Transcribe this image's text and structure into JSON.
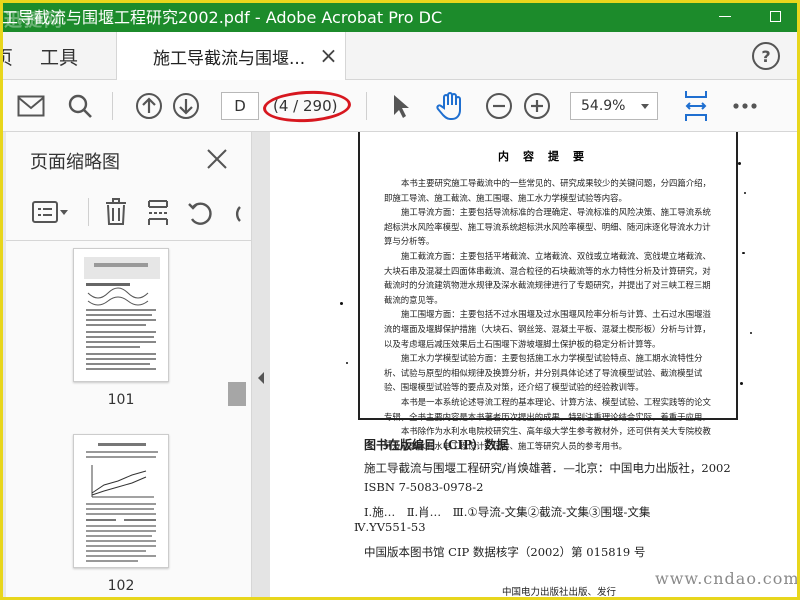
{
  "window": {
    "title": "工导截流与围堰工程研究2002.pdf - Adobe Acrobat Pro DC",
    "watermark": "迅捷网"
  },
  "tabs": {
    "home_partial": "页",
    "tools": "工具",
    "document": "施工导截流与围堰...",
    "close": "×",
    "help": "?"
  },
  "toolbar": {
    "page_input": "D",
    "page_count": "(4 / 290)",
    "zoom": "54.9%"
  },
  "sidepanel": {
    "title": "页面缩略图",
    "thumbnails": [
      {
        "label": "101"
      },
      {
        "label": "102"
      }
    ]
  },
  "document": {
    "heading": "内容提要",
    "paragraphs": [
      "本书主要研究施工导截流中的一些常见的、研究成果较少的关键问题，分四篇介绍，即施工导流、施工截流、施工围堰、施工水力学模型试验等内容。",
      "施工导流方面：主要包括导流标准的合理确定、导流标准的风险决策、施工导流系统超标洪水风险率模型、施工导流系统超标洪水风险率模型、明细、随河床逐化导流水力计算与分析等。",
      "施工截流方面：主要包括平堵截流、立堵截流、双戗或立堵截流、宽戗堤立堵截流、大块石串及混凝土四面体串截流、混合粒径的石块截流等的水力特性分析及计算研究，对截流时的分流建筑物泄水规律及深水截流规律进行了专题研究，并提出了对三峡工程三期截流的意见等。",
      "施工围堰方面：主要包括不过水围堰及过水围堰风险率分析与计算、土石过水围堰溢流的堰面及堰脚保护措施（大块石、钢丝笼、混凝土平板、混凝土楔形板）分析与计算，以及考虑堰后减压效果后土石围堰下游坡堰脚土保护板的稳定分析计算等。",
      "施工水力学模型试验方面：主要包括施工水力学模型试验特点、施工期水流特性分析、试验与原型的相似规律及换算分析，并分别具体论述了导流模型试验、截流模型试验、围堰模型试验等的要点及对策，还介绍了模型试验的经验教训等。",
      "本书是一本系统论述导流工程的基本理论、计算方法、模型试验、工程实践等的论文专辑，全书主要内容是本书著者历次提出的成果，特别注重理论结合实际，着重于应用。",
      "本书除作为水利水电院校研究生、高年级大学生参考教材外，还可供有关大专院校教师及从事水利水电工程设计、试验、施工等研究人员的参考用书。"
    ],
    "cip_title": "图书在版编目（CIP）数据",
    "cip_line1": "施工导截流与围堰工程研究/肖焕雄著．—北京：中国电力出版社，2002",
    "cip_line2": "ISBN 7-5083-0978-2",
    "cip_line3": "Ⅰ.施…　Ⅱ.肖…　Ⅲ.①导流-文集②截流-文集③围堰-文集",
    "cip_line4": "Ⅳ.YV551-53",
    "cip_line5": "中国版本图书馆 CIP 数据核字（2002）第 015819 号",
    "publisher_partial": "中国电力出版社出版、发行",
    "site_watermark": "www.cndao.com"
  },
  "colors": {
    "titlebar": "#1c8b2b",
    "highlight_oval": "#d7171f",
    "accent_blue": "#1f6fd0",
    "frame": "#e8d61c"
  }
}
